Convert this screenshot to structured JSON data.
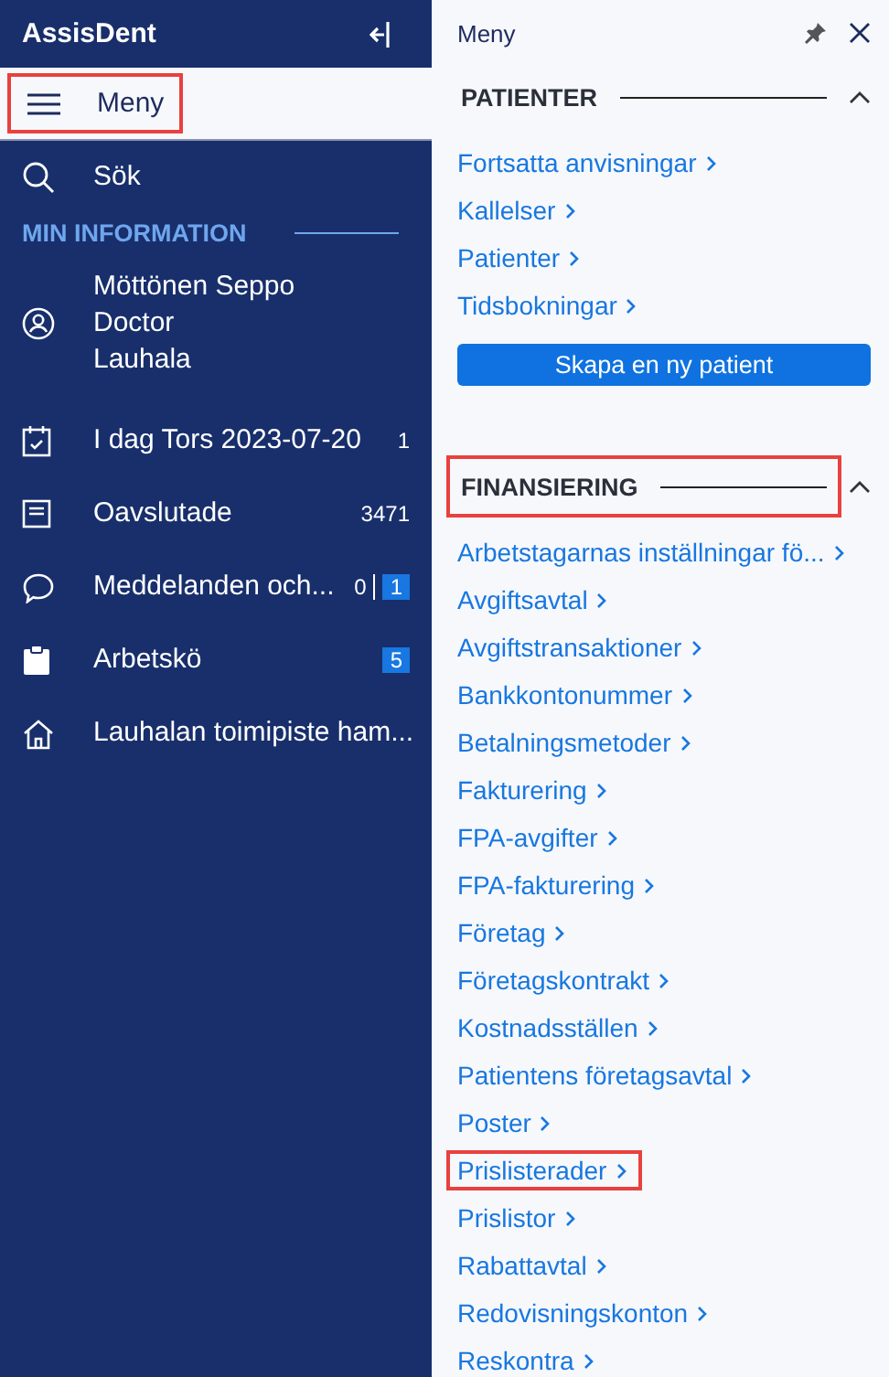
{
  "sidebar": {
    "brand": "AssisDent",
    "menu_item": {
      "label": "Meny",
      "selected": true,
      "highlighted": true
    },
    "search_item": {
      "label": "Sök"
    },
    "section_title": "MIN INFORMATION",
    "items": [
      {
        "kind": "profile",
        "lines": [
          "Möttönen Seppo",
          "Doctor",
          "Lauhala"
        ]
      },
      {
        "kind": "calendar",
        "lines": [
          "I dag Tors 2023-07-20"
        ],
        "count": "1"
      },
      {
        "kind": "document",
        "lines": [
          "Oavslutade"
        ],
        "count": "3471"
      },
      {
        "kind": "chat",
        "lines": [
          "Meddelanden och..."
        ],
        "count": "0",
        "badge": "1"
      },
      {
        "kind": "queue",
        "lines": [
          "Arbetskö"
        ],
        "badge": "5"
      },
      {
        "kind": "home",
        "lines": [
          "Lauhalan toimipiste ham..."
        ]
      }
    ]
  },
  "panel": {
    "title": "Meny",
    "sections": [
      {
        "title": "PATIENTER",
        "expanded": true,
        "highlighted": false,
        "links": [
          {
            "label": "Fortsatta anvisningar",
            "highlighted": false
          },
          {
            "label": "Kallelser",
            "highlighted": false
          },
          {
            "label": "Patienter",
            "highlighted": false
          },
          {
            "label": "Tidsbokningar",
            "highlighted": false
          }
        ],
        "button": "Skapa en ny patient"
      },
      {
        "title": "FINANSIERING",
        "expanded": true,
        "highlighted": true,
        "links": [
          {
            "label": "Arbetstagarnas inställningar fö...",
            "highlighted": false
          },
          {
            "label": "Avgiftsavtal",
            "highlighted": false
          },
          {
            "label": "Avgiftstransaktioner",
            "highlighted": false
          },
          {
            "label": "Bankkontonummer",
            "highlighted": false
          },
          {
            "label": "Betalningsmetoder",
            "highlighted": false
          },
          {
            "label": "Fakturering",
            "highlighted": false
          },
          {
            "label": "FPA-avgifter",
            "highlighted": false
          },
          {
            "label": "FPA-fakturering",
            "highlighted": false
          },
          {
            "label": "Företag",
            "highlighted": false
          },
          {
            "label": "Företagskontrakt",
            "highlighted": false
          },
          {
            "label": "Kostnadsställen",
            "highlighted": false
          },
          {
            "label": "Patientens företagsavtal",
            "highlighted": false
          },
          {
            "label": "Poster",
            "highlighted": false
          },
          {
            "label": "Prislisterader",
            "highlighted": true
          },
          {
            "label": "Prislistor",
            "highlighted": false
          },
          {
            "label": "Rabattavtal",
            "highlighted": false
          },
          {
            "label": "Redovisningskonton",
            "highlighted": false
          },
          {
            "label": "Reskontra",
            "highlighted": false
          }
        ]
      }
    ]
  }
}
